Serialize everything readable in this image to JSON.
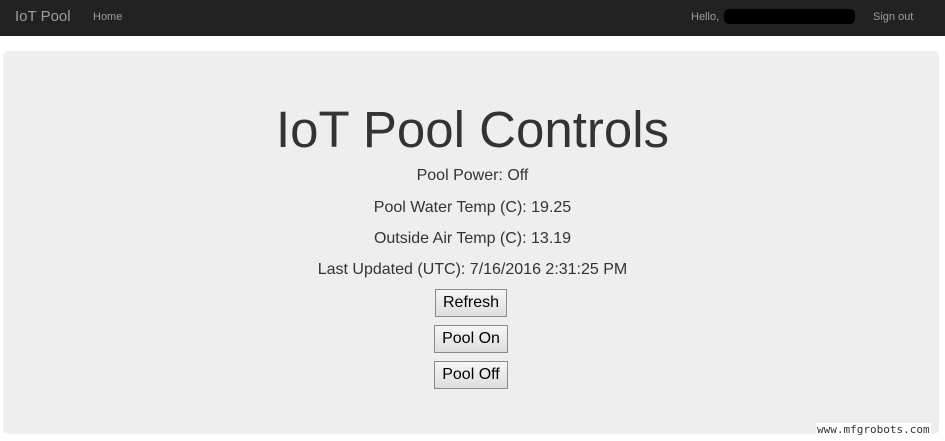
{
  "navbar": {
    "brand": "IoT Pool",
    "home": "Home",
    "hello": "Hello,",
    "sign_out": "Sign out"
  },
  "main": {
    "title": "IoT Pool Controls",
    "pool_power": "Pool Power: Off",
    "water_temp": "Pool Water Temp (C): 19.25",
    "air_temp": "Outside Air Temp (C): 13.19",
    "last_updated": "Last Updated (UTC): 7/16/2016 2:31:25 PM",
    "refresh_label": "Refresh",
    "pool_on_label": "Pool On",
    "pool_off_label": "Pool Off"
  },
  "watermark": "www.mfgrobots.com"
}
